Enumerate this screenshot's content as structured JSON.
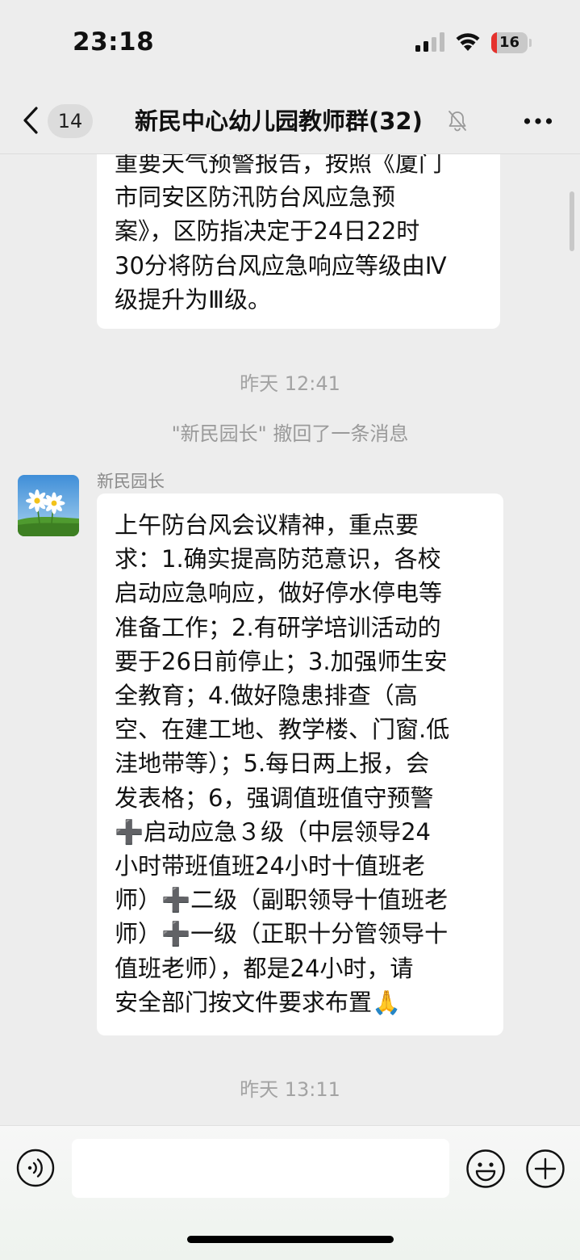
{
  "status_bar": {
    "time": "23:18",
    "battery_level": "16",
    "battery_fraction": 0.16,
    "battery_color": "#e5322d"
  },
  "nav": {
    "unread_count": "14",
    "title": "新民中心幼儿园教师群(32)",
    "icons": {
      "back": "chevron-left-icon",
      "mute": "bell-slash-icon",
      "more": "ellipsis-icon"
    }
  },
  "messages": [
    {
      "text": "重要天气预警报告，按照《厦门\n市同安区防汛防台风应急预\n案》，区防指决定于24日22时\n30分将防台风应急响应等级由Ⅳ\n级提升为Ⅲ级。"
    },
    {
      "sender": "新民园长",
      "text": "上午防台风会议精神，重点要\n求：1.确实提高防范意识，各校\n启动应急响应，做好停水停电等\n准备工作；2.有研学培训活动的\n要于26日前停止；3.加强师生安\n全教育；4.做好隐患排查（高\n空、在建工地、教学楼、门窗.低\n洼地带等）；5.每日两上报，会\n发表格；6，强调值班值守预警\n➕启动应急３级（中层领导24\n小时带班值班24小时十值班老\n师）➕二级（副职领导十值班老\n师）➕一级（正职十分管领导十\n值班老师），都是24小时，请\n安全部门按文件要求布置🙏"
    }
  ],
  "timestamps": [
    "昨天 12:41",
    "昨天 13:11"
  ],
  "recall_notice": "\"新民园长\" 撤回了一条消息",
  "input_bar": {
    "placeholder": "",
    "icons": {
      "voice": "voice-icon",
      "emoji": "emoji-icon",
      "plus": "plus-icon"
    }
  }
}
